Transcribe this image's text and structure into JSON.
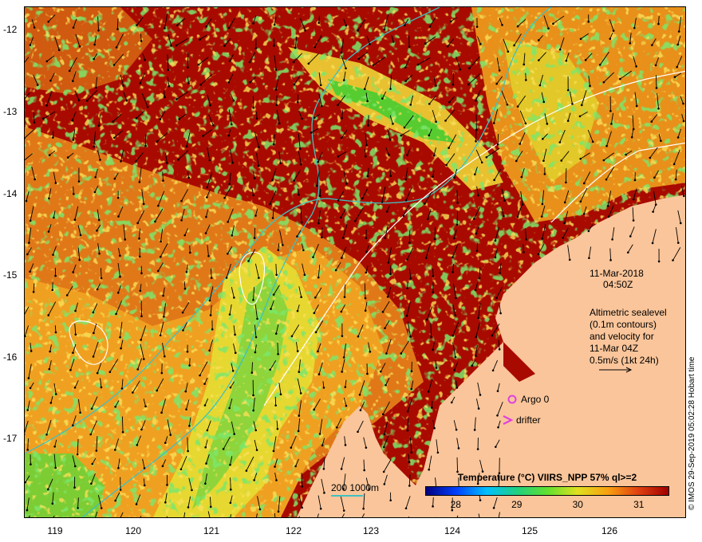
{
  "map": {
    "y_axis_labels": [
      "-12",
      "-13",
      "-14",
      "-15",
      "-16",
      "-17"
    ],
    "x_axis_labels": [
      "119",
      "120",
      "121",
      "122",
      "123",
      "124",
      "125",
      "126"
    ],
    "timestamp_date": "11-Mar-2018",
    "timestamp_time": "04:50Z",
    "legend_text_lines": [
      "Altimetric sealevel",
      "(0.1m contours)",
      "and velocity for",
      "11-Mar 04Z",
      "0.5m/s (1kt 24h)"
    ],
    "argo_label": "Argo 0",
    "drifter_label": "drifter",
    "bathymetry_label": "200  1000m",
    "credit": "© IMOS 29-Sep-2019 05:02:28 Hobart time",
    "colorbar": {
      "title": "Temperature (°C) VIIRS_NPP 57% ql>=2",
      "tick_labels": [
        "28",
        "29",
        "30",
        "31"
      ],
      "tick_values": [
        28,
        29,
        30,
        31
      ],
      "range": [
        27.5,
        31.5
      ]
    },
    "colors": {
      "land": "#fac59a",
      "hot": "#a80a00",
      "warm": "#d93a0a",
      "orange": "#f0a010",
      "yellow": "#e8e030",
      "green": "#3ccc2a",
      "contour_bathy": "#40c0c0",
      "contour_sealevel": "#ffffff",
      "argo": "#e040e0"
    }
  }
}
